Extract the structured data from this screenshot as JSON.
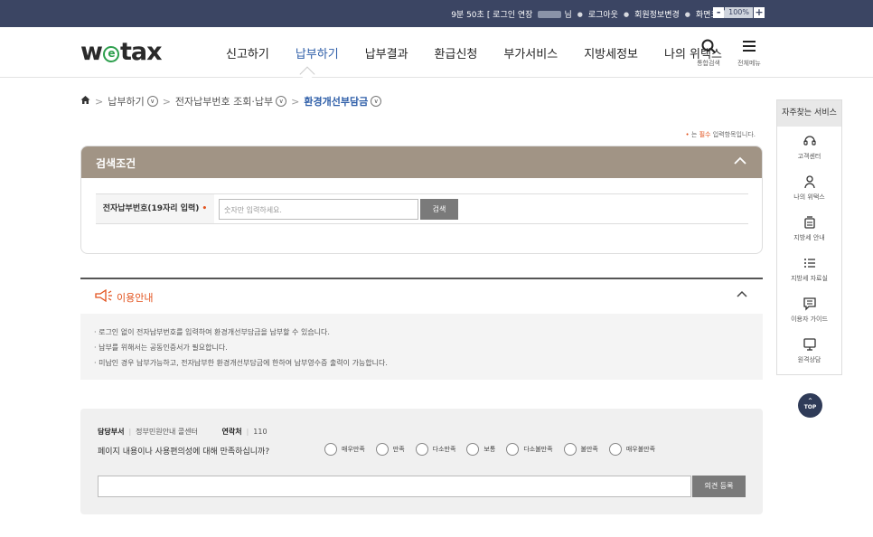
{
  "topbar": {
    "session": "9분 50초",
    "extend": "[ 로그인 연장",
    "user_suffix": "님",
    "logout": "로그아웃",
    "member_edit": "회원정보변경",
    "screen_size": "화면크기",
    "zoom_minus": "-",
    "zoom_value": "100%",
    "zoom_plus": "+"
  },
  "header": {
    "logo_w": "w",
    "logo_e": "e",
    "logo_rest": "tax",
    "menu": [
      "신고하기",
      "납부하기",
      "납부결과",
      "환급신청",
      "부가서비스",
      "지방세정보",
      "나의 위택스"
    ],
    "active_menu": "납부하기",
    "search_label": "통합검색",
    "all_menu_label": "전체메뉴",
    "search_icon": "search-icon",
    "menu_icon": "hamburger-icon"
  },
  "breadcrumb": {
    "home_icon": "home-icon",
    "items": [
      "납부하기",
      "전자납부번호 조회·납부",
      "환경개선부담금"
    ]
  },
  "required_note": {
    "mark": "•",
    "text1": "는 ",
    "text2": "필수",
    "text3": " 입력항목입니다."
  },
  "search": {
    "title": "검색조건",
    "label": "전자납부번호(19자리 입력)",
    "required": "•",
    "placeholder": "숫자만 입력하세요.",
    "button": "검색"
  },
  "info": {
    "title": "이용안내",
    "lines": [
      "· 로그인 없이 전자납부번호를 입력하여 환경개선부담금을 납부할 수 있습니다.",
      "· 납부를 위해서는 공동인증서가 필요합니다.",
      "· 미납인 경우 납부가능하고, 전자납부한 환경개선부담금에 한하여 납부영수증 출력이 가능합니다."
    ]
  },
  "satisfaction": {
    "dept_label": "담당부서",
    "dept_value": "정부민원안내 콜센터",
    "contact_label": "연락처",
    "contact_value": "110",
    "question": "페이지 내용이나 사용편의성에 대해 만족하십니까?",
    "options": [
      "매우만족",
      "만족",
      "다소만족",
      "보통",
      "다소불만족",
      "불만족",
      "매우불만족"
    ],
    "submit": "의견 등록"
  },
  "quick": {
    "title": "자주찾는 서비스",
    "items": [
      {
        "label": "고객센터",
        "icon": "headset-icon"
      },
      {
        "label": "나의 위택스",
        "icon": "person-icon"
      },
      {
        "label": "지방세 안내",
        "icon": "document-icon"
      },
      {
        "label": "지방세 자료실",
        "icon": "list-icon"
      },
      {
        "label": "이용자 가이드",
        "icon": "chat-icon"
      },
      {
        "label": "원격상담",
        "icon": "monitor-icon"
      }
    ],
    "top": "TOP"
  }
}
